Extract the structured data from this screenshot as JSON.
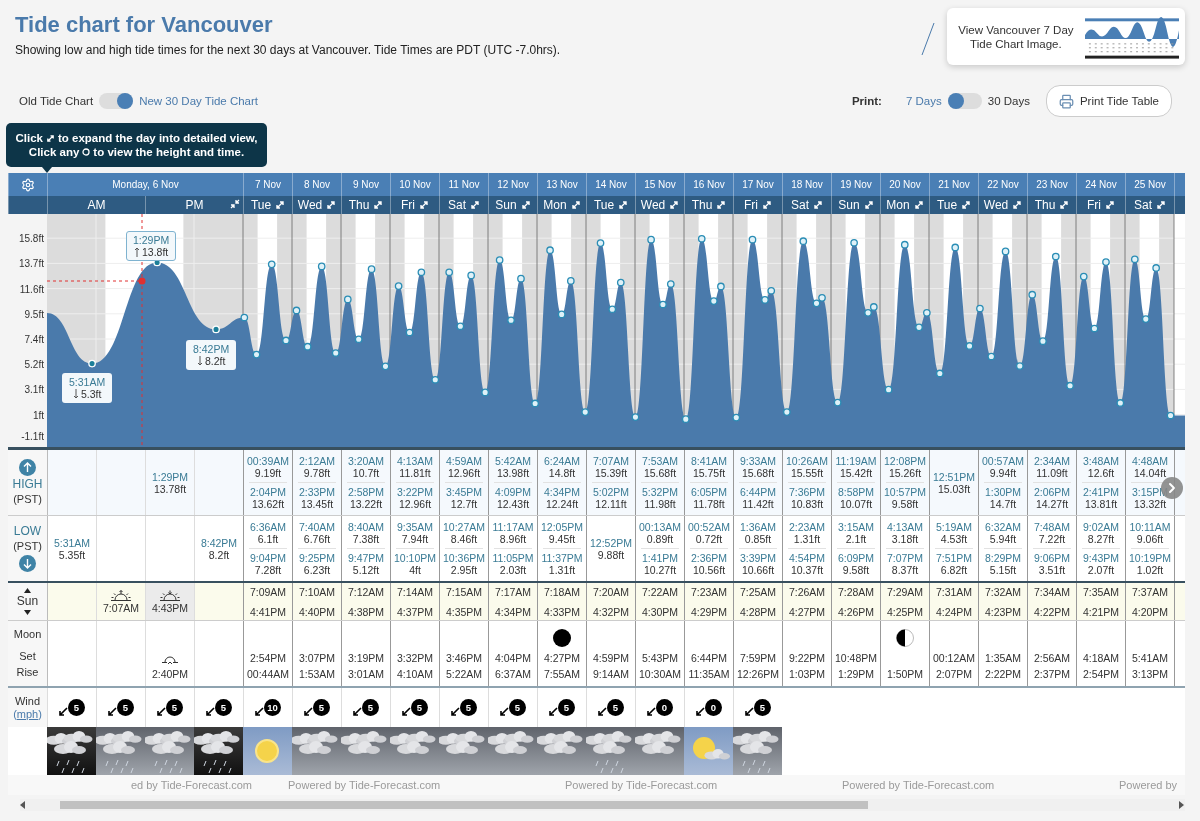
{
  "title": "Tide chart for Vancouver",
  "subtitle": "Showing low and high tide times for the next 30 days at Vancouver. Tide Times are PDT (UTC -7.0hrs).",
  "chart_toggle": {
    "left": "Old Tide Chart",
    "right": "New 30 Day Tide Chart",
    "on": true
  },
  "image_card": {
    "text": "View Vancouver 7 Day Tide Chart Image."
  },
  "print": {
    "label": "Print:",
    "options": [
      {
        "label": "7 Days",
        "selected": true
      },
      {
        "label": "30 Days",
        "selected": false
      }
    ],
    "button": "Print Tide Table"
  },
  "tooltip": {
    "lines": [
      {
        "before": "Click",
        "after": "to expand the day into detailed view,"
      },
      {
        "before": "Click any",
        "after": "to view the height and time."
      }
    ]
  },
  "chart": {
    "y_axis_labels": [
      "15.8ft",
      "13.7ft",
      "11.6ft",
      "9.5ft",
      "7.4ft",
      "5.2ft",
      "3.1ft",
      "1ft",
      "-1.1ft"
    ],
    "callouts": [
      {
        "time": "5:31AM",
        "height": "5.3ft",
        "kind": "low",
        "selected": false
      },
      {
        "time": "1:29PM",
        "height": "13.8ft",
        "kind": "high",
        "selected": true
      },
      {
        "time": "8:42PM",
        "height": "8.2ft",
        "kind": "low",
        "selected": false
      }
    ]
  },
  "row_labels": {
    "high": [
      "HIGH",
      "(PST)"
    ],
    "low": [
      "LOW",
      "(PST)"
    ],
    "sun": "Sun",
    "moon": [
      "Moon",
      "Set",
      "Rise"
    ],
    "wind": {
      "title": "Wind",
      "open": "(",
      "unit": "mph",
      "close": ")"
    }
  },
  "first_day": {
    "date": "Monday, 6 Nov",
    "halves": [
      "AM",
      "PM"
    ],
    "quarters": [
      {
        "low": [
          {
            "time": "5:31AM",
            "height": "5.35ft"
          }
        ],
        "wind": "5",
        "weather": {
          "kind": "rain-night"
        }
      },
      {
        "sun": {
          "kind": "sunrise",
          "time": "7:07AM",
          "highlighted": false
        },
        "wind": "5",
        "weather": {
          "kind": "rain"
        }
      },
      {
        "high": [
          {
            "time": "1:29PM",
            "height": "13.78ft"
          }
        ],
        "sun": {
          "kind": "sunset",
          "time": "4:43PM",
          "highlighted": true
        },
        "moon": {
          "kind": "moonset",
          "time": "2:40PM"
        },
        "wind": "5",
        "weather": {
          "kind": "rain"
        }
      },
      {
        "low": [
          {
            "time": "8:42PM",
            "height": "8.2ft"
          }
        ],
        "wind": "5",
        "weather": {
          "kind": "rain-night"
        }
      }
    ]
  },
  "days": [
    {
      "date": "7 Nov",
      "weekday": "Tue",
      "high": [
        {
          "time": "00:39AM",
          "height": "9.19ft"
        },
        {
          "time": "2:04PM",
          "height": "13.62ft"
        }
      ],
      "low": [
        {
          "time": "6:36AM",
          "height": "6.1ft"
        },
        {
          "time": "9:04PM",
          "height": "7.28ft"
        }
      ],
      "sun": [
        "7:09AM",
        "4:41PM"
      ],
      "moon": {
        "set": "2:54PM",
        "rise": "00:44AM"
      },
      "wind": "10",
      "weather": {
        "kind": "sun"
      }
    },
    {
      "date": "8 Nov",
      "weekday": "Wed",
      "high": [
        {
          "time": "2:12AM",
          "height": "9.78ft"
        },
        {
          "time": "2:33PM",
          "height": "13.45ft"
        }
      ],
      "low": [
        {
          "time": "7:40AM",
          "height": "6.76ft"
        },
        {
          "time": "9:25PM",
          "height": "6.23ft"
        }
      ],
      "sun": [
        "7:10AM",
        "4:40PM"
      ],
      "moon": {
        "set": "3:07PM",
        "rise": "1:53AM"
      },
      "wind": "5",
      "weather": {
        "kind": "cloud"
      }
    },
    {
      "date": "9 Nov",
      "weekday": "Thu",
      "high": [
        {
          "time": "3:20AM",
          "height": "10.7ft"
        },
        {
          "time": "2:58PM",
          "height": "13.22ft"
        }
      ],
      "low": [
        {
          "time": "8:40AM",
          "height": "7.38ft"
        },
        {
          "time": "9:47PM",
          "height": "5.12ft"
        }
      ],
      "sun": [
        "7:12AM",
        "4:38PM"
      ],
      "moon": {
        "set": "3:19PM",
        "rise": "3:01AM"
      },
      "wind": "5",
      "weather": {
        "kind": "cloud"
      }
    },
    {
      "date": "10 Nov",
      "weekday": "Fri",
      "high": [
        {
          "time": "4:13AM",
          "height": "11.81ft"
        },
        {
          "time": "3:22PM",
          "height": "12.96ft"
        }
      ],
      "low": [
        {
          "time": "9:35AM",
          "height": "7.94ft"
        },
        {
          "time": "10:10PM",
          "height": "4ft"
        }
      ],
      "sun": [
        "7:14AM",
        "4:37PM"
      ],
      "moon": {
        "set": "3:32PM",
        "rise": "4:10AM"
      },
      "wind": "5",
      "weather": {
        "kind": "cloud"
      }
    },
    {
      "date": "11 Nov",
      "weekday": "Sat",
      "high": [
        {
          "time": "4:59AM",
          "height": "12.96ft"
        },
        {
          "time": "3:45PM",
          "height": "12.7ft"
        }
      ],
      "low": [
        {
          "time": "10:27AM",
          "height": "8.46ft"
        },
        {
          "time": "10:36PM",
          "height": "2.95ft"
        }
      ],
      "sun": [
        "7:15AM",
        "4:35PM"
      ],
      "moon": {
        "set": "3:46PM",
        "rise": "5:22AM"
      },
      "wind": "5",
      "weather": {
        "kind": "cloud"
      }
    },
    {
      "date": "12 Nov",
      "weekday": "Sun",
      "high": [
        {
          "time": "5:42AM",
          "height": "13.98ft"
        },
        {
          "time": "4:09PM",
          "height": "12.43ft"
        }
      ],
      "low": [
        {
          "time": "11:17AM",
          "height": "8.96ft"
        },
        {
          "time": "11:05PM",
          "height": "2.03ft"
        }
      ],
      "sun": [
        "7:17AM",
        "4:34PM"
      ],
      "moon": {
        "set": "4:04PM",
        "rise": "6:37AM"
      },
      "wind": "5",
      "weather": {
        "kind": "cloud"
      }
    },
    {
      "date": "13 Nov",
      "weekday": "Mon",
      "high": [
        {
          "time": "6:24AM",
          "height": "14.8ft"
        },
        {
          "time": "4:34PM",
          "height": "12.24ft"
        }
      ],
      "low": [
        {
          "time": "12:05PM",
          "height": "9.45ft"
        },
        {
          "time": "11:37PM",
          "height": "1.31ft"
        }
      ],
      "sun": [
        "7:18AM",
        "4:33PM"
      ],
      "moon": {
        "kind": "new-moon",
        "set": "4:27PM",
        "rise": "7:55AM"
      },
      "wind": "5",
      "weather": {
        "kind": "cloud"
      }
    },
    {
      "date": "14 Nov",
      "weekday": "Tue",
      "high": [
        {
          "time": "7:07AM",
          "height": "15.39ft"
        },
        {
          "time": "5:02PM",
          "height": "12.11ft"
        }
      ],
      "low": [
        {
          "time": "12:52PM",
          "height": "9.88ft"
        }
      ],
      "sun": [
        "7:20AM",
        "4:32PM"
      ],
      "moon": {
        "set": "4:59PM",
        "rise": "9:14AM"
      },
      "wind": "5",
      "weather": {
        "kind": "rain"
      }
    },
    {
      "date": "15 Nov",
      "weekday": "Wed",
      "high": [
        {
          "time": "7:53AM",
          "height": "15.68ft"
        },
        {
          "time": "5:32PM",
          "height": "11.98ft"
        }
      ],
      "low": [
        {
          "time": "00:13AM",
          "height": "0.89ft"
        },
        {
          "time": "1:41PM",
          "height": "10.27ft"
        }
      ],
      "sun": [
        "7:22AM",
        "4:30PM"
      ],
      "moon": {
        "set": "5:43PM",
        "rise": "10:30AM"
      },
      "wind": "0",
      "weather": {
        "kind": "cloud"
      }
    },
    {
      "date": "16 Nov",
      "weekday": "Thu",
      "high": [
        {
          "time": "8:41AM",
          "height": "15.75ft"
        },
        {
          "time": "6:05PM",
          "height": "11.78ft"
        }
      ],
      "low": [
        {
          "time": "00:52AM",
          "height": "0.72ft"
        },
        {
          "time": "2:36PM",
          "height": "10.56ft"
        }
      ],
      "sun": [
        "7:23AM",
        "4:29PM"
      ],
      "moon": {
        "set": "6:44PM",
        "rise": "11:35AM"
      },
      "wind": "0",
      "weather": {
        "kind": "partly"
      }
    },
    {
      "date": "17 Nov",
      "weekday": "Fri",
      "high": [
        {
          "time": "9:33AM",
          "height": "15.68ft"
        },
        {
          "time": "6:44PM",
          "height": "11.42ft"
        }
      ],
      "low": [
        {
          "time": "1:36AM",
          "height": "0.85ft"
        },
        {
          "time": "3:39PM",
          "height": "10.66ft"
        }
      ],
      "sun": [
        "7:25AM",
        "4:28PM"
      ],
      "moon": {
        "set": "7:59PM",
        "rise": "12:26PM"
      },
      "wind": "5",
      "weather": {
        "kind": "rain"
      }
    },
    {
      "date": "18 Nov",
      "weekday": "Sat",
      "high": [
        {
          "time": "10:26AM",
          "height": "15.55ft"
        },
        {
          "time": "7:36PM",
          "height": "10.83ft"
        }
      ],
      "low": [
        {
          "time": "2:23AM",
          "height": "1.31ft"
        },
        {
          "time": "4:54PM",
          "height": "10.37ft"
        }
      ],
      "sun": [
        "7:26AM",
        "4:27PM"
      ],
      "moon": {
        "set": "9:22PM",
        "rise": "1:03PM"
      }
    },
    {
      "date": "19 Nov",
      "weekday": "Sun",
      "high": [
        {
          "time": "11:19AM",
          "height": "15.42ft"
        },
        {
          "time": "8:58PM",
          "height": "10.07ft"
        }
      ],
      "low": [
        {
          "time": "3:15AM",
          "height": "2.1ft"
        },
        {
          "time": "6:09PM",
          "height": "9.58ft"
        }
      ],
      "sun": [
        "7:28AM",
        "4:26PM"
      ],
      "moon": {
        "set": "10:48PM",
        "rise": "1:29PM"
      }
    },
    {
      "date": "20 Nov",
      "weekday": "Mon",
      "high": [
        {
          "time": "12:08PM",
          "height": "15.26ft"
        },
        {
          "time": "10:57PM",
          "height": "9.58ft"
        }
      ],
      "low": [
        {
          "time": "4:13AM",
          "height": "3.18ft"
        },
        {
          "time": "7:07PM",
          "height": "8.37ft"
        }
      ],
      "sun": [
        "7:29AM",
        "4:25PM"
      ],
      "moon": {
        "kind": "half-moon",
        "rise": "1:50PM"
      }
    },
    {
      "date": "21 Nov",
      "weekday": "Tue",
      "high": [
        {
          "time": "12:51PM",
          "height": "15.03ft"
        }
      ],
      "low": [
        {
          "time": "5:19AM",
          "height": "4.53ft"
        },
        {
          "time": "7:51PM",
          "height": "6.82ft"
        }
      ],
      "sun": [
        "7:31AM",
        "4:24PM"
      ],
      "moon": {
        "set": "00:12AM",
        "rise": "2:07PM"
      }
    },
    {
      "date": "22 Nov",
      "weekday": "Wed",
      "high": [
        {
          "time": "00:57AM",
          "height": "9.94ft"
        },
        {
          "time": "1:30PM",
          "height": "14.7ft"
        }
      ],
      "low": [
        {
          "time": "6:32AM",
          "height": "5.94ft"
        },
        {
          "time": "8:29PM",
          "height": "5.15ft"
        }
      ],
      "sun": [
        "7:32AM",
        "4:23PM"
      ],
      "moon": {
        "set": "1:35AM",
        "rise": "2:22PM"
      }
    },
    {
      "date": "23 Nov",
      "weekday": "Thu",
      "high": [
        {
          "time": "2:34AM",
          "height": "11.09ft"
        },
        {
          "time": "2:06PM",
          "height": "14.27ft"
        }
      ],
      "low": [
        {
          "time": "7:48AM",
          "height": "7.22ft"
        },
        {
          "time": "9:06PM",
          "height": "3.51ft"
        }
      ],
      "sun": [
        "7:34AM",
        "4:22PM"
      ],
      "moon": {
        "set": "2:56AM",
        "rise": "2:37PM"
      }
    },
    {
      "date": "24 Nov",
      "weekday": "Fri",
      "high": [
        {
          "time": "3:48AM",
          "height": "12.6ft"
        },
        {
          "time": "2:41PM",
          "height": "13.81ft"
        }
      ],
      "low": [
        {
          "time": "9:02AM",
          "height": "8.27ft"
        },
        {
          "time": "9:43PM",
          "height": "2.07ft"
        }
      ],
      "sun": [
        "7:35AM",
        "4:21PM"
      ],
      "moon": {
        "set": "4:18AM",
        "rise": "2:54PM"
      }
    },
    {
      "date": "25 Nov",
      "weekday": "Sat",
      "high": [
        {
          "time": "4:48AM",
          "height": "14.04ft"
        },
        {
          "time": "3:15PM",
          "height": "13.32ft"
        }
      ],
      "low": [
        {
          "time": "10:11AM",
          "height": "9.06ft"
        },
        {
          "time": "10:19PM",
          "height": "1.02ft"
        }
      ],
      "sun": [
        "7:37AM",
        "4:20PM"
      ],
      "moon": {
        "set": "5:41AM",
        "rise": "3:13PM"
      }
    }
  ],
  "footer": [
    "ed by Tide-Forecast.com",
    "Powered by Tide-Forecast.com",
    "Powered by Tide-Forecast.com",
    "Powered by Tide-Forecast.com",
    "Powered by"
  ]
}
